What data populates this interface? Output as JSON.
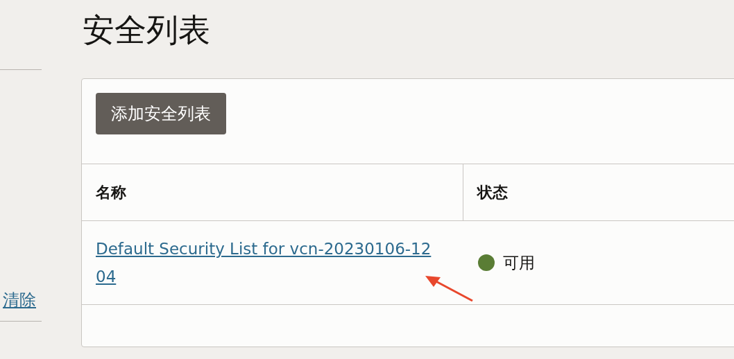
{
  "sidebar": {
    "clear_link": "清除"
  },
  "page_title": "安全列表",
  "add_button": "添加安全列表",
  "table": {
    "columns": [
      "名称",
      "状态"
    ],
    "rows": [
      {
        "name": "Default Security List for vcn-20230106-1204",
        "status": "可用",
        "color": "#5a7d35"
      }
    ]
  }
}
